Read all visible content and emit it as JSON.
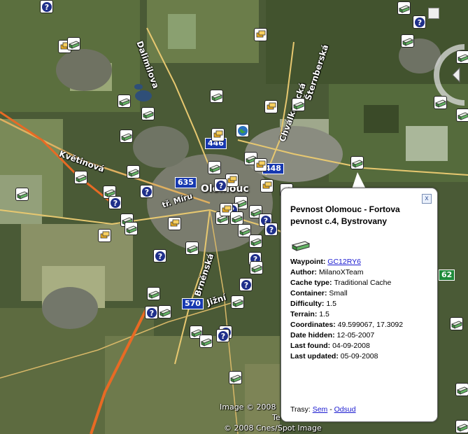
{
  "map": {
    "city": "Olomouc",
    "streets": [
      "Dalimilova",
      "Chválkovická",
      "Šternberská",
      "Květinová",
      "tř. Míru",
      "Brněnská",
      "Jižní"
    ],
    "road_shields": [
      "446",
      "448",
      "635",
      "570",
      "62"
    ],
    "copyright": [
      "Image © 2008",
      "Te",
      "© 2008 Cnes/Spot Image"
    ],
    "icons": {
      "traditional": "ammo-box-icon",
      "unknown": "question-mark-icon",
      "multi": "multi-cache-icon",
      "earth": "earthcache-icon"
    }
  },
  "balloon": {
    "title": "Pevnost Olomouc - Fortova pevnost c.4, Bystrovany",
    "close_label": "x",
    "fields": [
      {
        "label": "Waypoint:",
        "value": "GC12RY6",
        "link": true
      },
      {
        "label": "Author:",
        "value": "MilanoXTeam"
      },
      {
        "label": "Cache type:",
        "value": "Traditional Cache"
      },
      {
        "label": "Container:",
        "value": "Small"
      },
      {
        "label": "Difficulty:",
        "value": "1.5"
      },
      {
        "label": "Terrain:",
        "value": "1.5"
      },
      {
        "label": "Coordinates:",
        "value": "49.599067, 17.3092"
      },
      {
        "label": "Date hidden:",
        "value": "12-05-2007"
      },
      {
        "label": "Last found:",
        "value": "04-09-2008"
      },
      {
        "label": "Last updated:",
        "value": "05-09-2008"
      }
    ],
    "footer_prefix": "Trasy:",
    "footer_link_1": "Sem",
    "footer_separator": "-",
    "footer_link_2": "Odsud"
  }
}
